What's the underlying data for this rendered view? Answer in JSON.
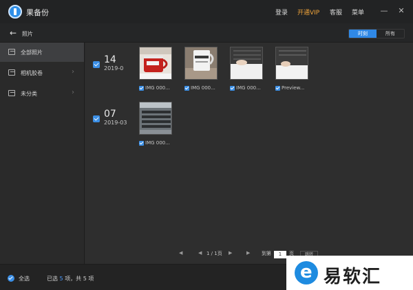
{
  "app": {
    "title": "果备份"
  },
  "topnav": {
    "login": "登录",
    "vip": "开通VIP",
    "service": "客服",
    "menu": "菜单"
  },
  "window": {
    "minimize": "—",
    "close": "✕"
  },
  "subbar": {
    "back": "←",
    "title": "照片",
    "seg_time": "时刻",
    "seg_all": "所有"
  },
  "sidebar": {
    "items": [
      {
        "label": "全部照片",
        "active": true
      },
      {
        "label": "相机胶卷",
        "active": false
      },
      {
        "label": "未分类",
        "active": false
      }
    ]
  },
  "groups": [
    {
      "day": "14",
      "year_month": "2019-0",
      "items": [
        {
          "caption": "IMG 000..."
        },
        {
          "caption": "IMG 000..."
        },
        {
          "caption": "IMG 000..."
        },
        {
          "caption": "Preview..."
        }
      ]
    },
    {
      "day": "07",
      "year_month": "2019-03",
      "items": [
        {
          "caption": "IMG 000..."
        }
      ]
    }
  ],
  "pager": {
    "first": "◀",
    "prev": "◀",
    "page_info": "1 / 1页",
    "next": "▶",
    "last": "▶",
    "goto_label": "到第",
    "goto_value": "1",
    "page_suffix": "页",
    "go": "跳转"
  },
  "bottombar": {
    "select_all": "全选",
    "selected_prefix": "已选",
    "selected_count": "5",
    "selected_mid": "项，共",
    "total_count": "5",
    "selected_suffix": "项"
  },
  "watermark": {
    "text": "易软汇"
  },
  "colors": {
    "accent": "#2f88e6",
    "vip": "#f0a43a",
    "background": "#2e2e2e"
  }
}
